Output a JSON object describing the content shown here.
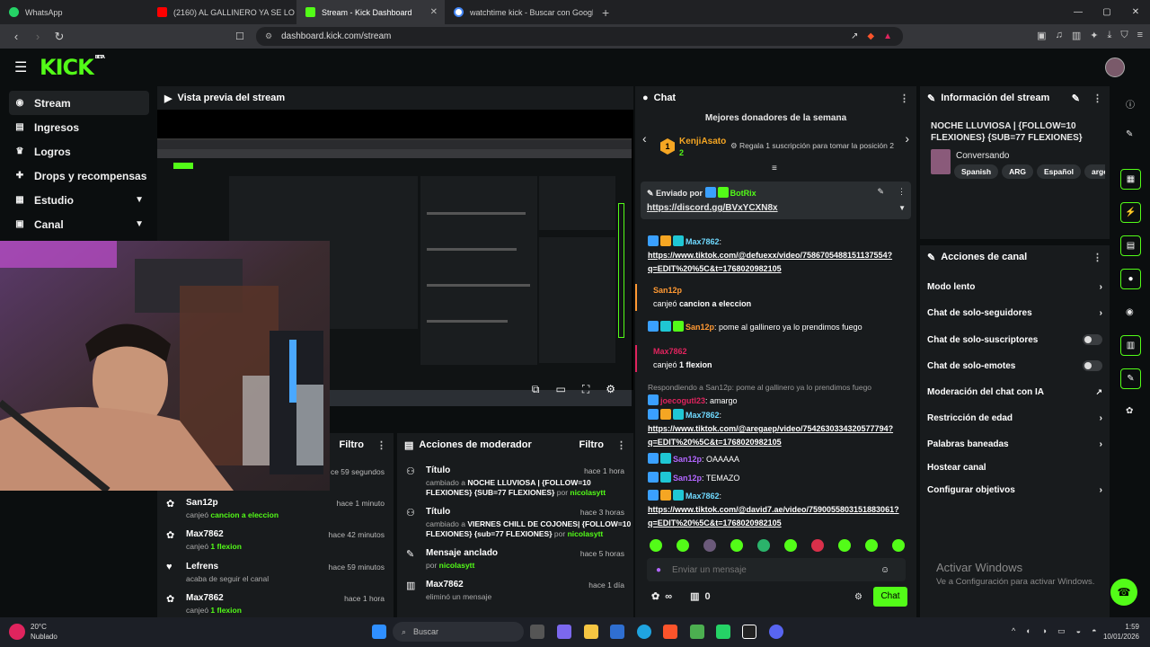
{
  "browser": {
    "tabs": [
      {
        "label": "WhatsApp",
        "color": "#25d366",
        "active": false
      },
      {
        "label": "(2160) AL GALLINERO YA SE LO P",
        "color": "#ff0000",
        "active": false
      },
      {
        "label": "Stream - Kick Dashboard",
        "color": "#53fc18",
        "active": true
      },
      {
        "label": "watchtime kick - Buscar con Google",
        "color": "#4285f4",
        "active": false
      }
    ],
    "url": "dashboard.kick.com/stream"
  },
  "app": {
    "logo": "KICK",
    "logo_sup": "BETA",
    "colors": {
      "accent": "#53fc18",
      "bg": "#0b0e0f",
      "panel": "#181b1d"
    }
  },
  "sidebar": {
    "items": [
      {
        "label": "Stream",
        "icon": "stream-icon",
        "active": true
      },
      {
        "label": "Ingresos",
        "icon": "revenue-icon"
      },
      {
        "label": "Logros",
        "icon": "trophy-icon"
      },
      {
        "label": "Drops y recompensas",
        "icon": "gift-icon"
      },
      {
        "label": "Estudio",
        "icon": "studio-icon",
        "chevron": true
      },
      {
        "label": "Canal",
        "icon": "channel-icon",
        "chevron": true
      }
    ]
  },
  "preview": {
    "title": "Vista previa del stream"
  },
  "activity": {
    "filter_label": "Filtro",
    "first_time": "ce 59 segundos",
    "items": [
      {
        "user": "San12p",
        "action": "canjeó ",
        "highlight": "cancion a eleccion",
        "time": "hace 1 minuto",
        "icon": "channel-points-icon"
      },
      {
        "user": "Max7862",
        "action": "canjeó ",
        "highlight": "1 flexion",
        "time": "hace 42 minutos",
        "icon": "channel-points-icon"
      },
      {
        "user": "Lefrens",
        "action": "acaba de seguir el canal",
        "highlight": "",
        "time": "hace 59 minutos",
        "icon": "heart-icon"
      },
      {
        "user": "Max7862",
        "action": "canjeó ",
        "highlight": "1 flexion",
        "time": "hace 1 hora",
        "icon": "channel-points-icon"
      }
    ]
  },
  "moderator": {
    "title": "Acciones de moderador",
    "filter_label": "Filtro",
    "items": [
      {
        "title": "Título",
        "line1": "cambiado a ",
        "bold1": "NOCHE LLUVIOSA | {FOLLOW=10",
        "bold2": "FLEXIONES} {SUB=77 FLEXIONES}",
        "by": "por ",
        "mod": "nicolasytt",
        "time": "hace 1 hora",
        "icon": "title-change-icon"
      },
      {
        "title": "Título",
        "line1": "cambiado a ",
        "bold1": "VIERNES CHILL DE COJONES| {FOLLOW=10",
        "bold2": "FLEXIONES} {sub=77 FLEXIONES}",
        "by": "por ",
        "mod": "nicolasytt",
        "time": "hace 3 horas",
        "icon": "title-change-icon"
      },
      {
        "title": "Mensaje anclado",
        "line1": "por ",
        "mod": "nicolasytt",
        "time": "hace 5 horas",
        "icon": "pin-icon"
      },
      {
        "title": "Max7862",
        "line1": "eliminó un mensaje",
        "time": "hace 1 día",
        "icon": "trash-icon"
      }
    ]
  },
  "chat": {
    "title": "Chat",
    "donors_title": "Mejores donadores de la semana",
    "top_donor": {
      "name": "KenjiAsato",
      "rank": "1",
      "count": "2",
      "cta": "Regala 1 suscripción para tomar la posición 2"
    },
    "pinned": {
      "label": "Enviado por",
      "user": "BotRix",
      "link": "https://discord.gg/BVxYCXN8x"
    },
    "messages": [
      {
        "user": "Max7862",
        "color": "#6fd9ff",
        "link1": "https://www.tiktok.com/@defuexx/video/7586705488151137554?",
        "link2": "q=EDIT%20%5C&t=1768020982105"
      },
      {
        "user": "San12p",
        "color": "#ff9933",
        "text": "canjeó ",
        "bold": "cancion a eleccion",
        "redeem": true
      },
      {
        "user": "San12p",
        "color": "#ff9933",
        "text": ": pome al gallinero ya lo prendimos fuego"
      },
      {
        "user": "Max7862",
        "color": "#e0245e",
        "text": "canjeó ",
        "bold": "1 flexion",
        "redeem": true
      },
      {
        "reply": "Respondiendo a San12p: pome al gallinero ya lo prendimos fuego",
        "user": "joecogutl23",
        "color": "#e0245e",
        "text": ": amargo"
      },
      {
        "user": "Max7862",
        "color": "#6fd9ff",
        "link1": "https://www.tiktok.com/@aregaep/video/7542630334320577794?",
        "link2": "q=EDIT%20%5C&t=1768020982105"
      },
      {
        "user": "San12p",
        "color": "#b266ff",
        "text": ": OAAAAA"
      },
      {
        "user": "San12p",
        "color": "#b266ff",
        "text": ": TEMAZO"
      },
      {
        "user": "Max7862",
        "color": "#6fd9ff",
        "link1": "https://www.tiktok.com/@david7.ae/video/7590055803151883061?",
        "link2": "q=EDIT%20%5C&t=1768020982105"
      }
    ],
    "input_placeholder": "Enviar un mensaje",
    "points": "∞",
    "gift_count": "0",
    "send_label": "Chat"
  },
  "info": {
    "title": "Información del stream",
    "stream_title": "NOCHE LLUVIOSA | {FOLLOW=10 FLEXIONES} {SUB=77 FLEXIONES}",
    "category": "Conversando",
    "tags": [
      "Spanish",
      "ARG",
      "Español",
      "argentin"
    ]
  },
  "channel_actions": {
    "title": "Acciones de canal",
    "items": [
      {
        "label": "Modo lento",
        "control": "chevron"
      },
      {
        "label": "Chat de solo-seguidores",
        "control": "chevron"
      },
      {
        "label": "Chat de solo-suscriptores",
        "control": "toggle"
      },
      {
        "label": "Chat de solo-emotes",
        "control": "toggle"
      },
      {
        "label": "Moderación del chat con IA",
        "control": "external"
      },
      {
        "label": "Restricción de edad",
        "control": "chevron"
      },
      {
        "label": "Palabras baneadas",
        "control": "chevron"
      },
      {
        "label": "Hostear canal",
        "control": "none"
      },
      {
        "label": "Configurar objetivos",
        "control": "chevron"
      }
    ]
  },
  "windows": {
    "activate_title": "Activar Windows",
    "activate_sub": "Ve a Configuración para activar Windows.",
    "weather_temp": "20°C",
    "weather_desc": "Nublado",
    "search_placeholder": "Buscar",
    "time": "1:59",
    "date": "10/01/2026"
  }
}
